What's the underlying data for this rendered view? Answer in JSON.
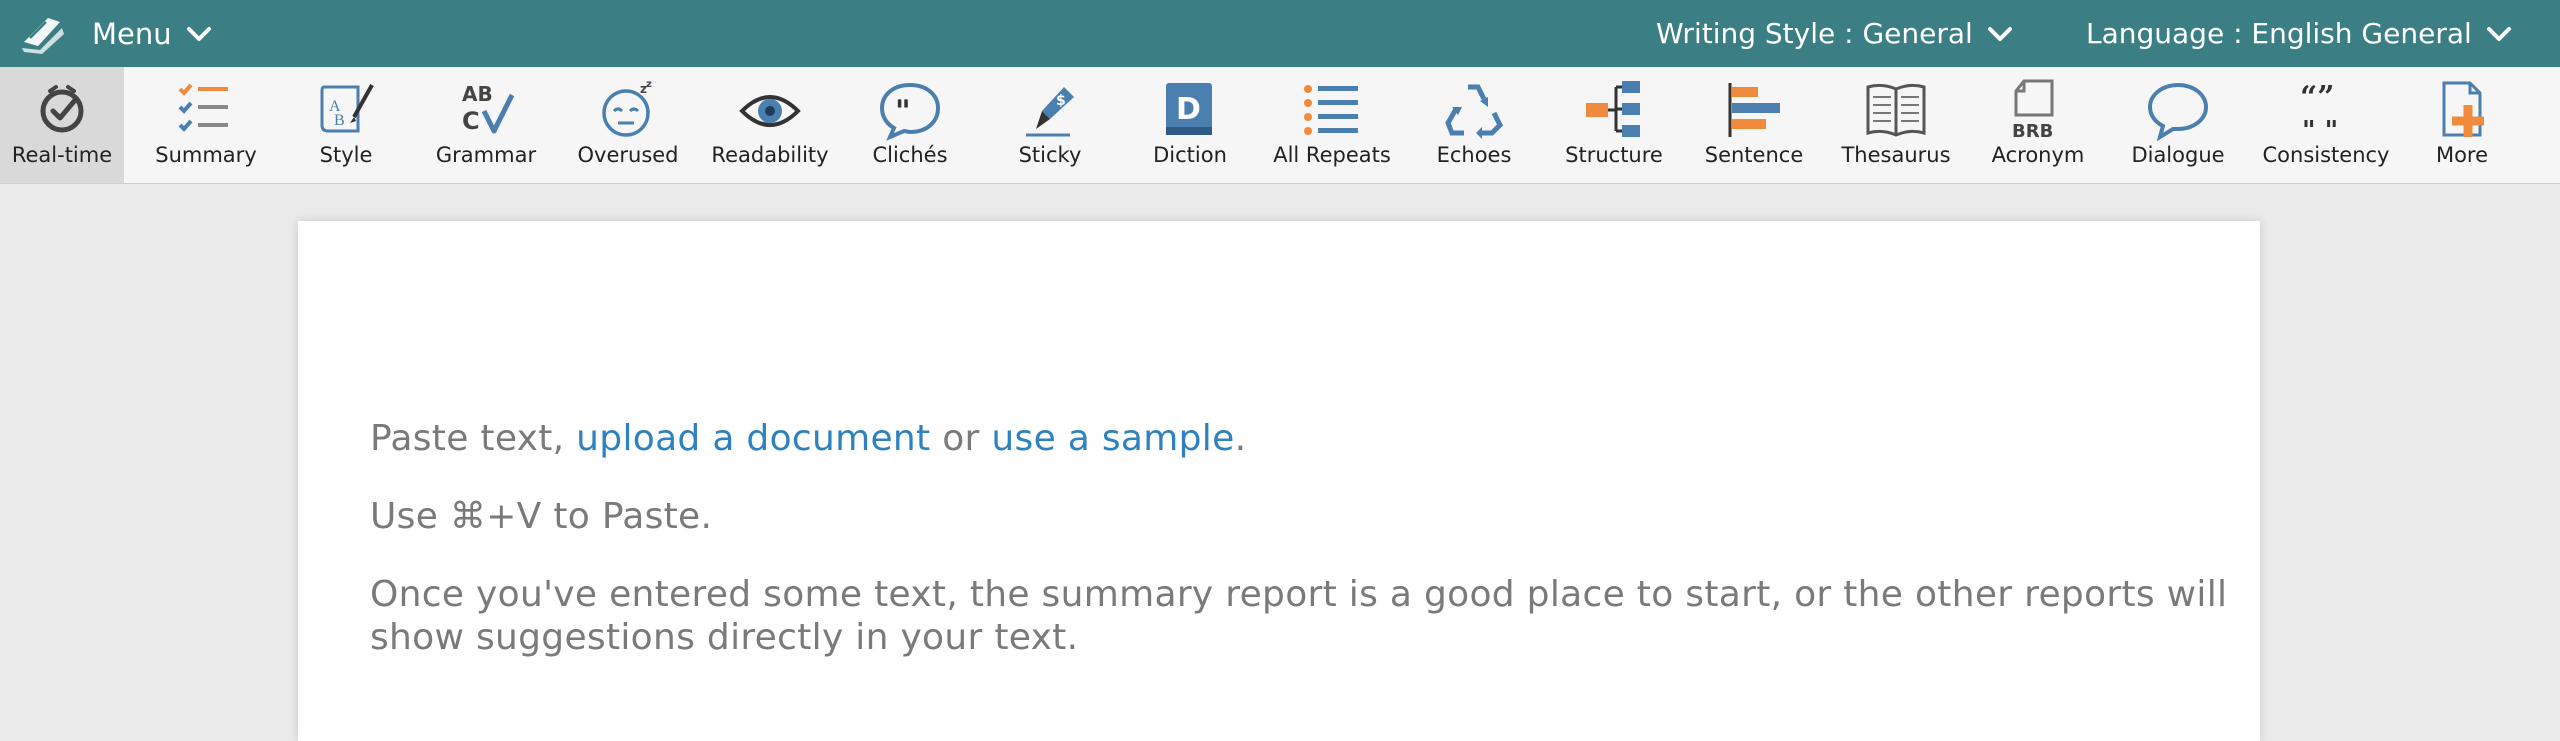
{
  "topbar": {
    "menu_label": "Menu",
    "writing_style": "Writing Style : General",
    "language": "Language : English General"
  },
  "toolbar": {
    "items": [
      {
        "label": "Real-time",
        "icon": "realtime-check-icon"
      },
      {
        "label": "Summary",
        "icon": "summary-checklist-icon"
      },
      {
        "label": "Style",
        "icon": "style-scroll-icon"
      },
      {
        "label": "Grammar",
        "icon": "grammar-abc-icon"
      },
      {
        "label": "Overused",
        "icon": "overused-sleepy-face-icon"
      },
      {
        "label": "Readability",
        "icon": "readability-eye-icon"
      },
      {
        "label": "Clichés",
        "icon": "cliches-quote-bubble-icon"
      },
      {
        "label": "Sticky",
        "icon": "sticky-pen-icon"
      },
      {
        "label": "Diction",
        "icon": "diction-book-icon"
      },
      {
        "label": "All Repeats",
        "icon": "all-repeats-list-icon"
      },
      {
        "label": "Echoes",
        "icon": "echoes-recycle-icon"
      },
      {
        "label": "Structure",
        "icon": "structure-tree-icon"
      },
      {
        "label": "Sentence",
        "icon": "sentence-bars-icon"
      },
      {
        "label": "Thesaurus",
        "icon": "thesaurus-open-book-icon"
      },
      {
        "label": "Acronym",
        "icon": "acronym-brb-icon"
      },
      {
        "label": "Dialogue",
        "icon": "dialogue-bubble-icon"
      },
      {
        "label": "Consistency",
        "icon": "consistency-quotes-icon"
      },
      {
        "label": "More",
        "icon": "more-plus-document-icon"
      }
    ]
  },
  "editor": {
    "paste_text": "Paste text,",
    "upload_link": "upload a document",
    "or_text": "or",
    "sample_link": "use a sample",
    "period": ".",
    "shortcut_hint": "Use ⌘+V to Paste.",
    "summary_hint": "Once you've entered some text, the summary report is a good place to start, or the other reports will show suggestions directly in your text."
  },
  "colors": {
    "topbar": "#3b7f85",
    "link": "#2f82c0",
    "icon_blue": "#4a7fb0",
    "icon_orange": "#f08a3c",
    "text_gray": "#7a7a7a"
  }
}
